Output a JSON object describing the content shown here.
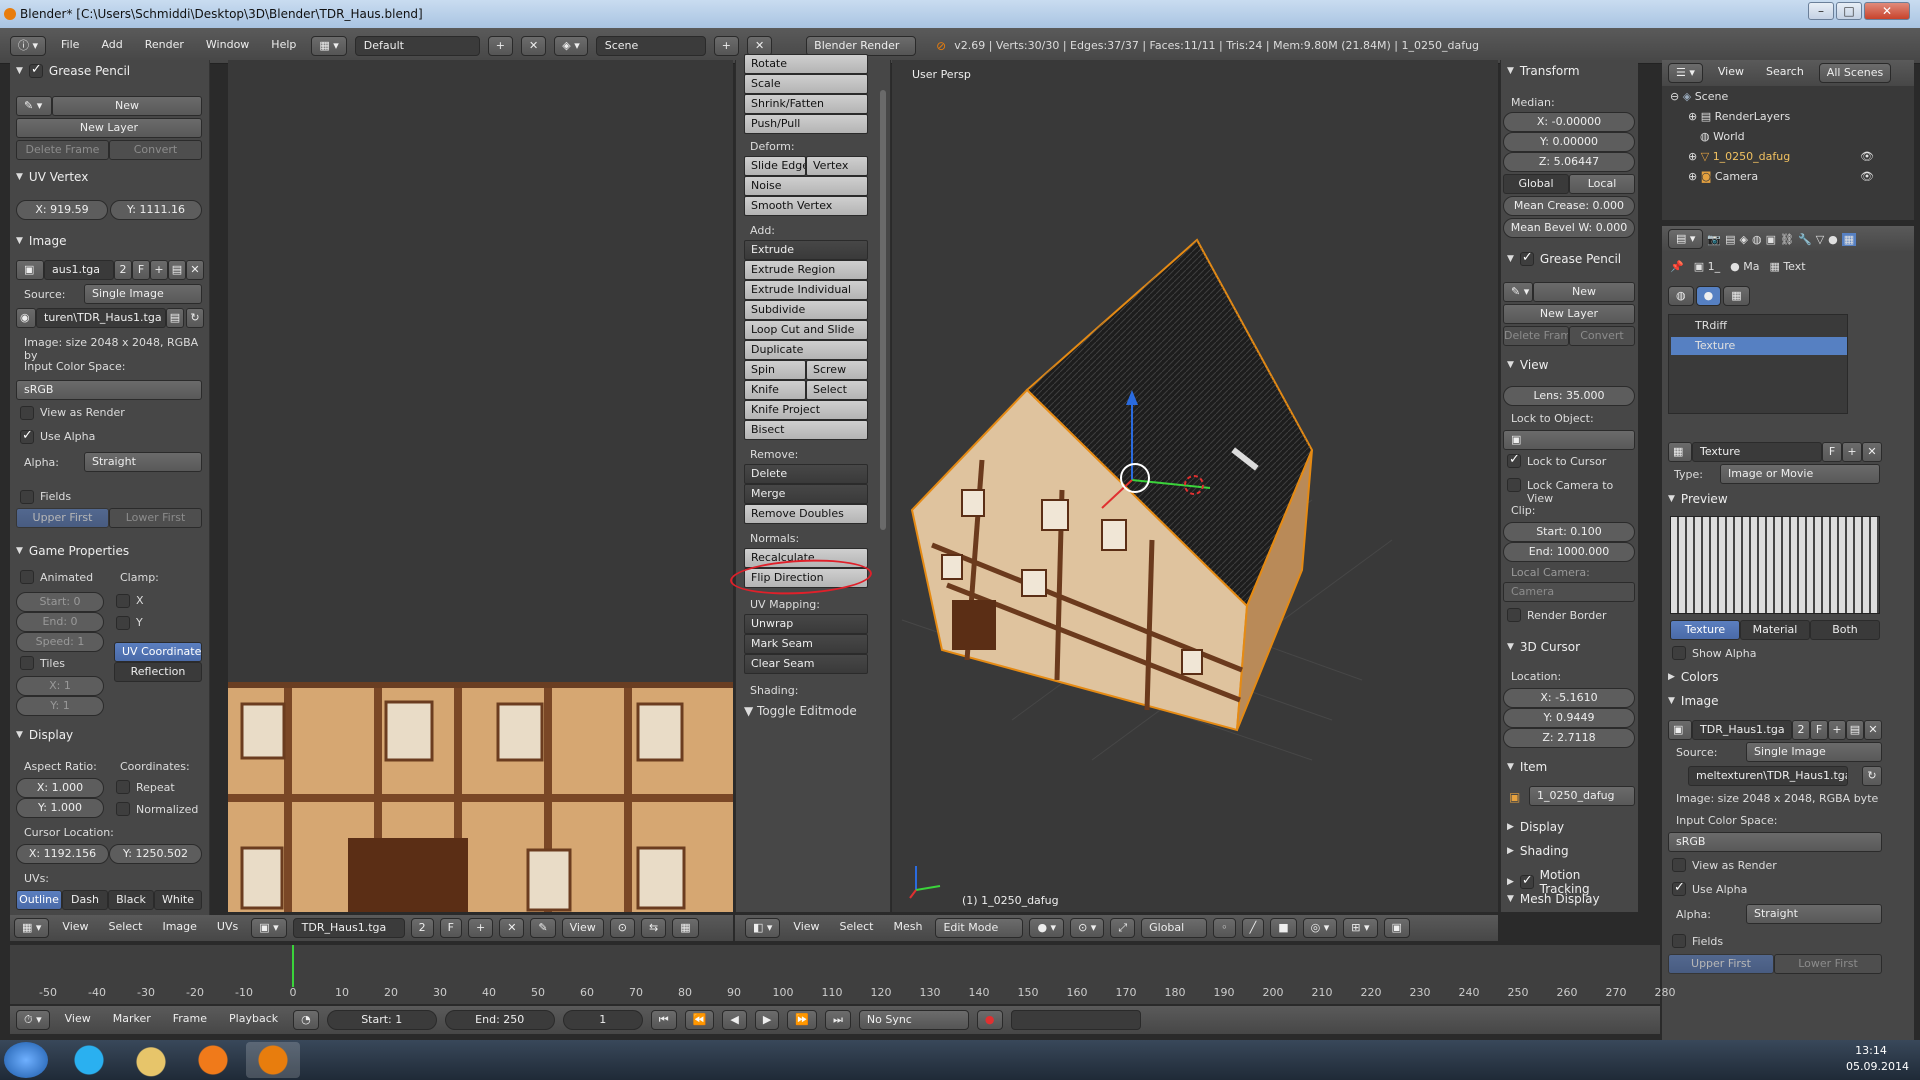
{
  "title": "Blender* [C:\\Users\\Schmiddi\\Desktop\\3D\\Blender\\TDR_Haus.blend]",
  "menu": {
    "file": "File",
    "add": "Add",
    "render": "Render",
    "window": "Window",
    "help": "Help"
  },
  "screen_layout": "Default",
  "scene": "Scene",
  "engine": "Blender Render",
  "stats": "v2.69 | Verts:30/30 | Edges:37/37 | Faces:11/11 | Tris:24 | Mem:9.80M (21.84M) | 1_0250_dafug",
  "left": {
    "grease_pencil": {
      "title": "Grease Pencil",
      "new": "New",
      "new_layer": "New Layer",
      "delete_frame": "Delete Frame",
      "convert": "Convert"
    },
    "uv_vertex": {
      "title": "UV Vertex",
      "x": "X: 919.59",
      "y": "Y: 1111.16"
    },
    "image": {
      "title": "Image",
      "name": "aus1.tga",
      "users": "2",
      "f": "F",
      "source_label": "Source:",
      "source": "Single Image",
      "path": "turen\\TDR_Haus1.tga",
      "info": "Image: size 2048 x 2048, RGBA by",
      "ics_label": "Input Color Space:",
      "ics": "sRGB",
      "view_as_render": "View as Render",
      "use_alpha": "Use Alpha",
      "alpha_label": "Alpha:",
      "alpha": "Straight",
      "fields": "Fields",
      "upper_first": "Upper First",
      "lower_first": "Lower First"
    },
    "game": {
      "title": "Game Properties",
      "animated": "Animated",
      "clamp": "Clamp:",
      "start": "Start: 0",
      "end": "End: 0",
      "speed": "Speed: 1",
      "x": "X",
      "y": "Y",
      "uv_coords": "UV Coordinates",
      "reflection": "Reflection",
      "tiles": "Tiles",
      "tx": "X: 1",
      "ty": "Y: 1"
    },
    "display": {
      "title": "Display",
      "aspect": "Aspect Ratio:",
      "coords": "Coordinates:",
      "ax": "X: 1.000",
      "ay": "Y: 1.000",
      "repeat": "Repeat",
      "normalized": "Normalized",
      "cursor_loc": "Cursor Location:",
      "cx": "X: 1192.156",
      "cy": "Y: 1250.502",
      "uvs": "UVs:",
      "outline": "Outline",
      "dash": "Dash",
      "black": "Black",
      "white": "White"
    }
  },
  "uv_header": {
    "view": "View",
    "select": "Select",
    "image": "Image",
    "uvs": "UVs",
    "img": "TDR_Haus1.tga",
    "users": "2",
    "f": "F",
    "view2": "View"
  },
  "tools": {
    "top": [
      "Rotate",
      "Scale",
      "Shrink/Fatten",
      "Push/Pull"
    ],
    "deform_label": "Deform:",
    "slide_edge": "Slide Edge",
    "vertex": "Vertex",
    "noise": "Noise",
    "smooth_vertex": "Smooth Vertex",
    "add_label": "Add:",
    "extrude": "Extrude",
    "extrude_region": "Extrude Region",
    "extrude_individual": "Extrude Individual",
    "subdivide": "Subdivide",
    "loop_cut": "Loop Cut and Slide",
    "duplicate": "Duplicate",
    "spin": "Spin",
    "screw": "Screw",
    "knife": "Knife",
    "select": "Select",
    "knife_project": "Knife Project",
    "bisect": "Bisect",
    "remove_label": "Remove:",
    "delete": "Delete",
    "merge": "Merge",
    "remove_doubles": "Remove Doubles",
    "normals_label": "Normals:",
    "recalculate": "Recalculate",
    "flip_direction": "Flip Direction",
    "uv_mapping_label": "UV Mapping:",
    "unwrap": "Unwrap",
    "mark_seam": "Mark Seam",
    "clear_seam": "Clear Seam",
    "shading_label": "Shading:",
    "toggle_editmode": "Toggle Editmode"
  },
  "viewport": {
    "label": "User Persp",
    "object": "(1) 1_0250_dafug"
  },
  "vp_header": {
    "view": "View",
    "select": "Select",
    "mesh": "Mesh",
    "mode": "Edit Mode",
    "orientation": "Global"
  },
  "props": {
    "transform": "Transform",
    "median": "Median:",
    "x": "X: -0.00000",
    "y": "Y: 0.00000",
    "z": "Z: 5.06447",
    "global": "Global",
    "local": "Local",
    "mean_crease": "Mean Crease: 0.000",
    "mean_bevel": "Mean Bevel W: 0.000",
    "grease_pencil": "Grease Pencil",
    "new": "New",
    "new_layer": "New Layer",
    "delete_frame": "Delete Fram",
    "convert": "Convert",
    "view": "View",
    "lens": "Lens: 35.000",
    "lock_to_object": "Lock to Object:",
    "lock_to_cursor": "Lock to Cursor",
    "lock_camera": "Lock Camera to View",
    "clip": "Clip:",
    "clip_start": "Start: 0.100",
    "clip_end": "End: 1000.000",
    "local_camera": "Local Camera:",
    "camera": "Camera",
    "render_border": "Render Border",
    "cursor3d": "3D Cursor",
    "location": "Location:",
    "cx": "X: -5.1610",
    "cy": "Y: 0.9449",
    "cz": "Z: 2.7118",
    "item": "Item",
    "item_name": "1_0250_dafug",
    "display": "Display",
    "shading": "Shading",
    "motion_tracking": "Motion Tracking",
    "mesh_display": "Mesh Display"
  },
  "outliner": {
    "view": "View",
    "search": "Search",
    "all_scenes": "All Scenes",
    "items": [
      "Scene",
      "RenderLayers",
      "World",
      "1_0250_dafug",
      "Camera"
    ]
  },
  "texture": {
    "breadcrumb_obj": "1_",
    "breadcrumb_mat": "Ma",
    "breadcrumb_tex": "Text",
    "slots": [
      "TRdiff",
      "Texture"
    ],
    "name": "Texture",
    "f": "F",
    "type_label": "Type:",
    "type": "Image or Movie",
    "preview": "Preview",
    "tab_texture": "Texture",
    "tab_material": "Material",
    "tab_both": "Both",
    "show_alpha": "Show Alpha",
    "colors": "Colors",
    "image": "Image",
    "img": "TDR_Haus1.tga",
    "users": "2",
    "f2": "F",
    "source_label": "Source:",
    "source": "Single Image",
    "path": "meltexturen\\TDR_Haus1.tga",
    "info": "Image: size 2048 x 2048, RGBA byte",
    "ics_label": "Input Color Space:",
    "ics": "sRGB",
    "view_as_render": "View as Render",
    "use_alpha": "Use Alpha",
    "alpha_label": "Alpha:",
    "alpha": "Straight",
    "fields": "Fields",
    "upper_first": "Upper First",
    "lower_first": "Lower First"
  },
  "timeline": {
    "ticks": [
      "-50",
      "-40",
      "-30",
      "-20",
      "-10",
      "0",
      "10",
      "20",
      "30",
      "40",
      "50",
      "60",
      "70",
      "80",
      "90",
      "100",
      "110",
      "120",
      "130",
      "140",
      "150",
      "160",
      "170",
      "180",
      "190",
      "200",
      "210",
      "220",
      "230",
      "240",
      "250",
      "260",
      "270",
      "280"
    ],
    "view": "View",
    "marker": "Marker",
    "frame": "Frame",
    "playback": "Playback",
    "start": "Start: 1",
    "end": "End: 250",
    "current": "1",
    "sync": "No Sync"
  },
  "taskbar": {
    "time": "13:14",
    "date": "05.09.2014"
  },
  "colors": {
    "selection": "#e58a13",
    "accent": "#5680c2",
    "flip_highlight": "#e0202a"
  }
}
